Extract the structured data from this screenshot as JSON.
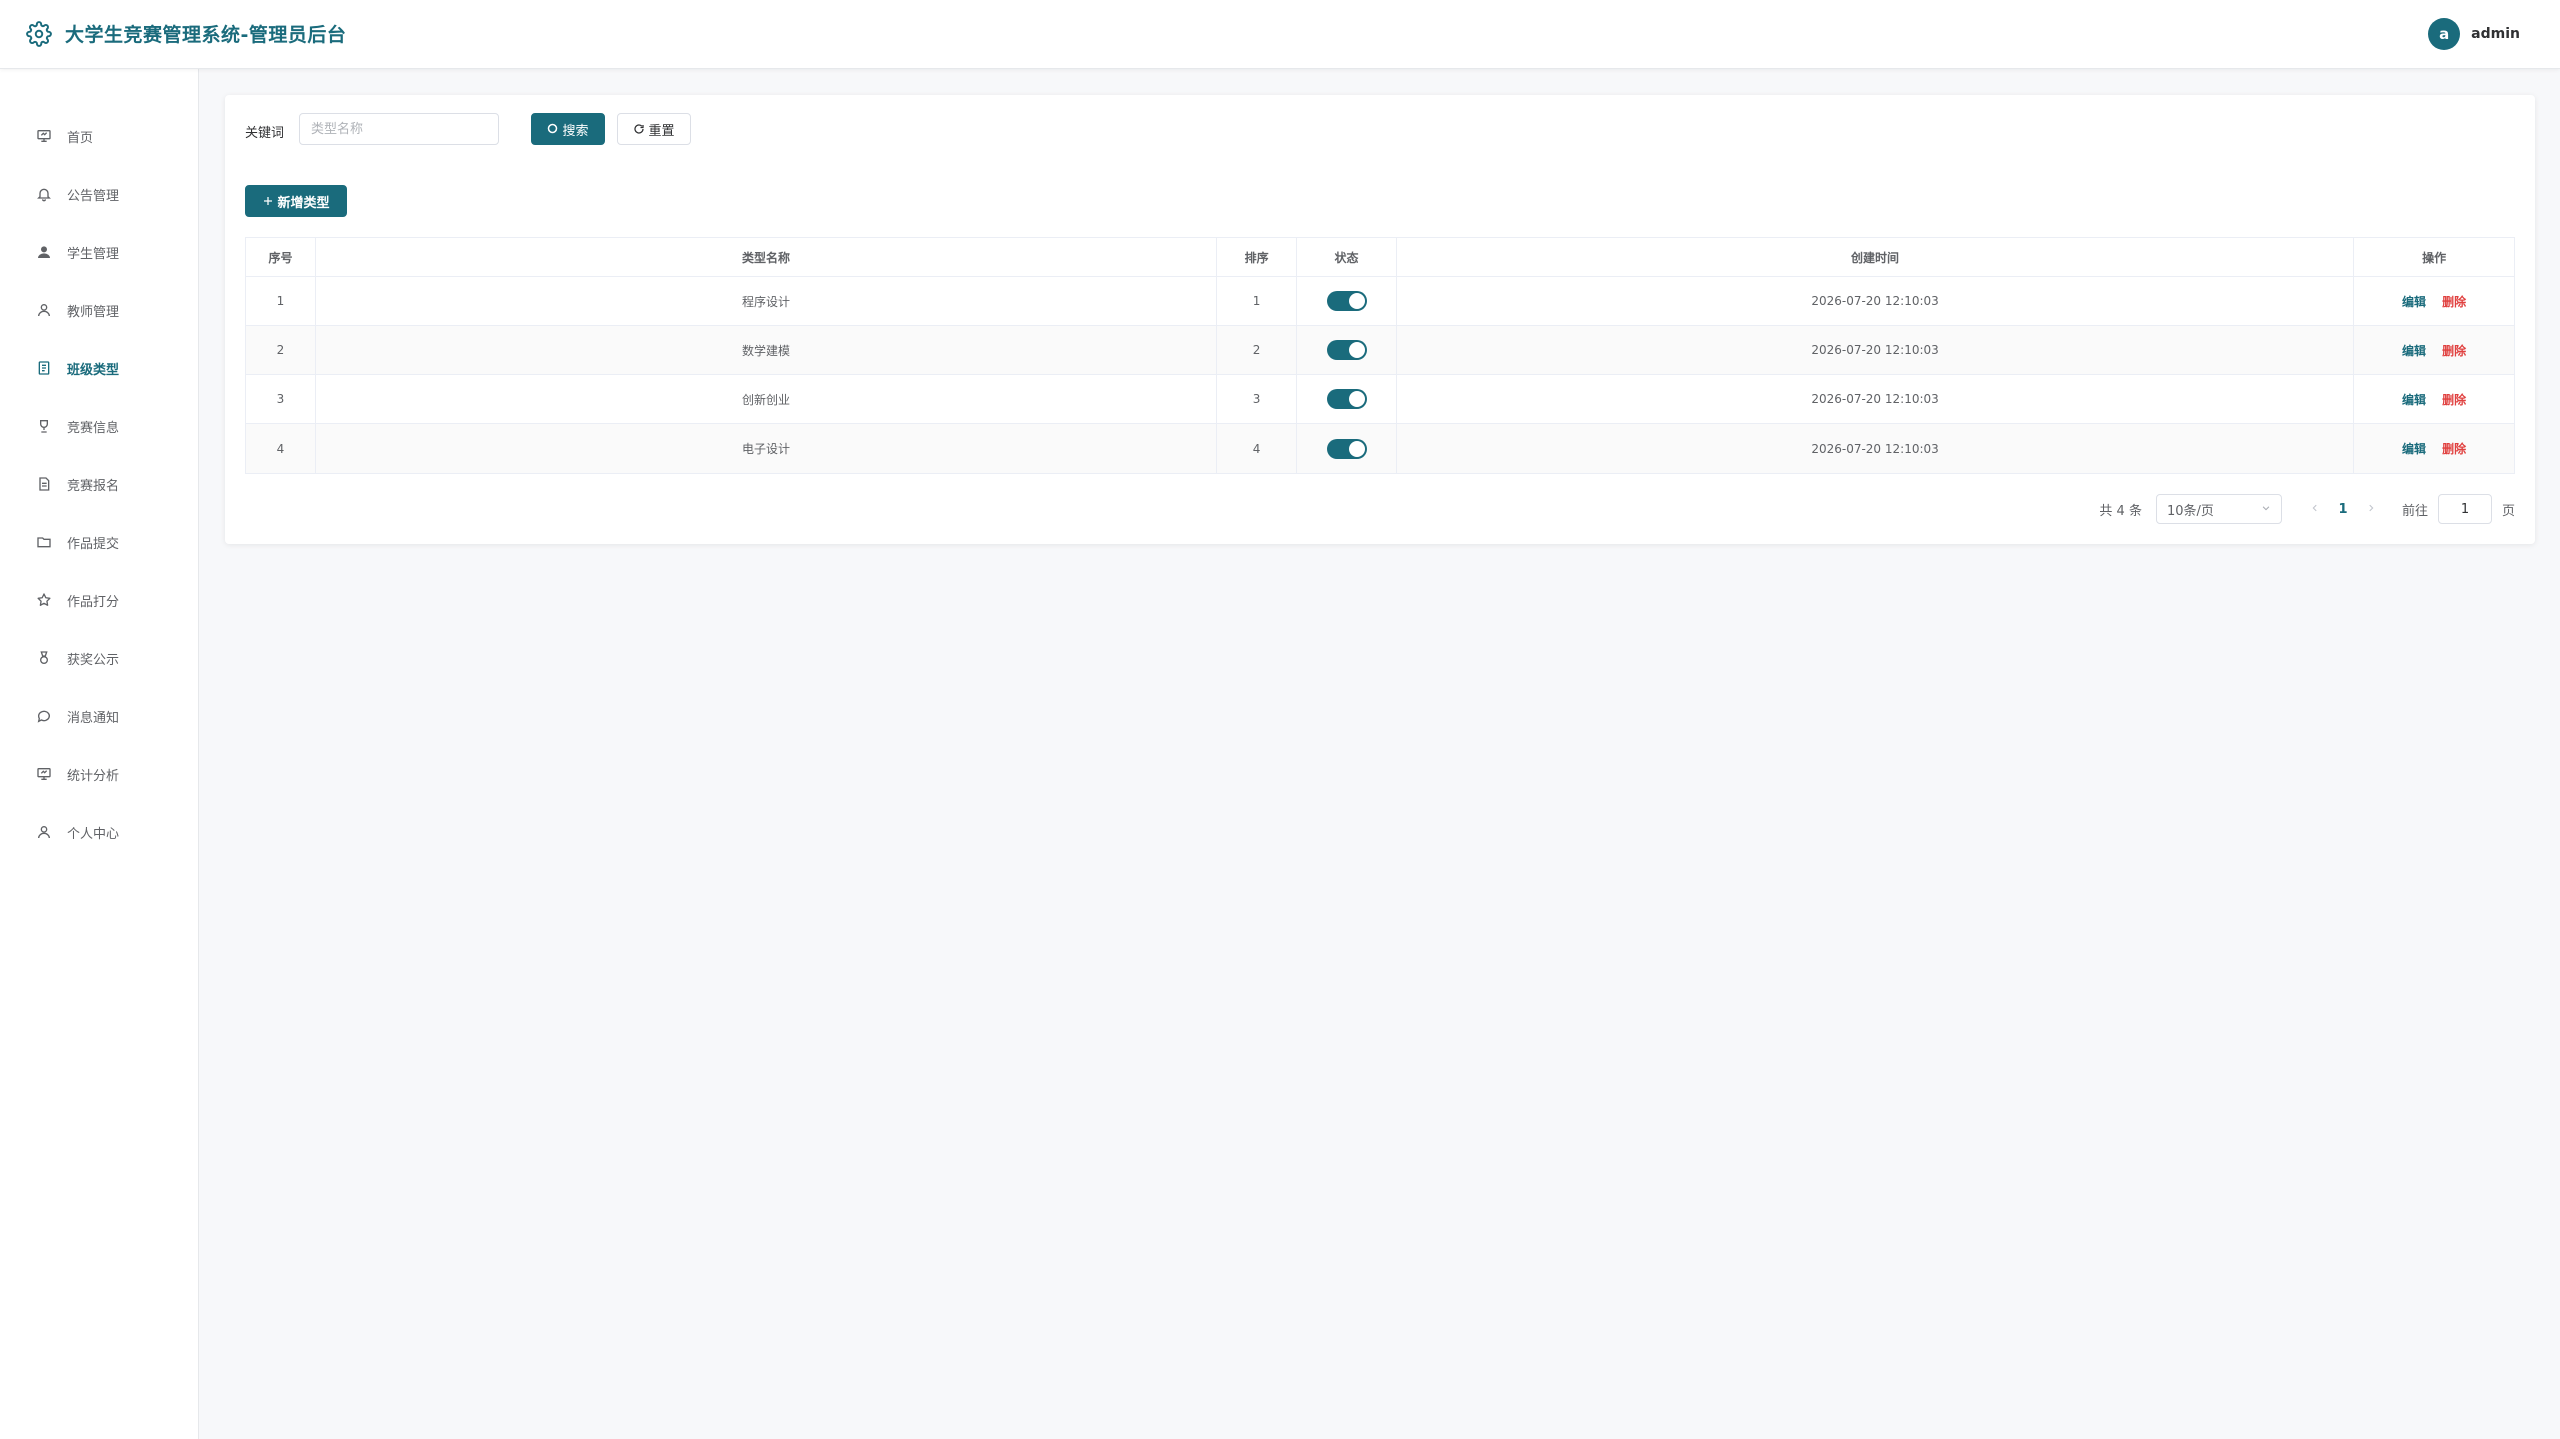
{
  "header": {
    "title": "大学生竞赛管理系统-管理员后台",
    "avatar_letter": "a",
    "username": "admin",
    "accent_color": "#1a6b7c"
  },
  "sidebar": {
    "active_index": 4,
    "items": [
      {
        "label": "首页",
        "icon": "monitor-icon"
      },
      {
        "label": "公告管理",
        "icon": "bell-icon"
      },
      {
        "label": "学生管理",
        "icon": "user-filled-icon"
      },
      {
        "label": "教师管理",
        "icon": "user-icon"
      },
      {
        "label": "班级类型",
        "icon": "notebook-icon"
      },
      {
        "label": "竞赛信息",
        "icon": "trophy-icon"
      },
      {
        "label": "竞赛报名",
        "icon": "document-icon"
      },
      {
        "label": "作品提交",
        "icon": "folder-icon"
      },
      {
        "label": "作品打分",
        "icon": "star-icon"
      },
      {
        "label": "获奖公示",
        "icon": "medal-icon"
      },
      {
        "label": "消息通知",
        "icon": "chat-icon"
      },
      {
        "label": "统计分析",
        "icon": "data-board-icon"
      },
      {
        "label": "个人中心",
        "icon": "user-icon"
      }
    ]
  },
  "search": {
    "label": "关键词",
    "placeholder": "类型名称",
    "value": "",
    "search_label": "搜索",
    "reset_label": "重置"
  },
  "toolbar": {
    "add_label": "新增类型"
  },
  "table": {
    "columns": [
      "序号",
      "类型名称",
      "排序",
      "状态",
      "创建时间",
      "操作"
    ],
    "rows": [
      {
        "index": "1",
        "name": "程序设计",
        "sort": "1",
        "enabled": true,
        "created": "2026-07-20 12:10:03"
      },
      {
        "index": "2",
        "name": "数学建模",
        "sort": "2",
        "enabled": true,
        "created": "2026-07-20 12:10:03"
      },
      {
        "index": "3",
        "name": "创新创业",
        "sort": "3",
        "enabled": true,
        "created": "2026-07-20 12:10:03"
      },
      {
        "index": "4",
        "name": "电子设计",
        "sort": "4",
        "enabled": true,
        "created": "2026-07-20 12:10:03"
      }
    ],
    "edit_label": "编辑",
    "delete_label": "删除"
  },
  "pagination": {
    "total_text": "共 4 条",
    "page_size": "10条/页",
    "current_page": "1",
    "goto_label": "前往",
    "goto_value": "1",
    "page_suffix": "页"
  }
}
